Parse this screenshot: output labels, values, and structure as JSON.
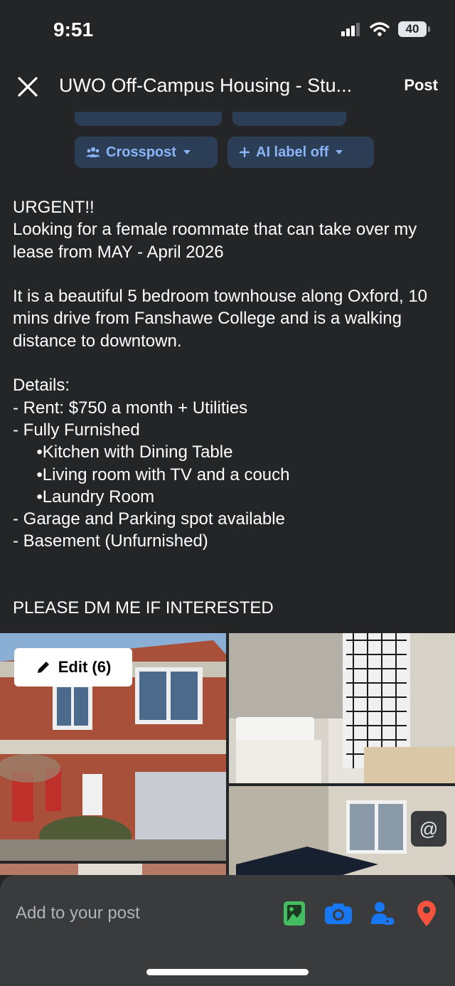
{
  "status_bar": {
    "time": "9:51",
    "battery": "40"
  },
  "header": {
    "title": "UWO Off-Campus Housing - Stu...",
    "post_label": "Post"
  },
  "chips": {
    "crosspost": "Crosspost",
    "ai_label": "AI label off"
  },
  "post": {
    "text": "URGENT!!\nLooking for a female roommate that can take over my lease from MAY - April 2026\n\nIt is a beautiful 5 bedroom townhouse along Oxford, 10 mins drive from Fanshawe College and is a walking distance to downtown.\n\nDetails:\n- Rent: $750 a month + Utilities\n- Fully Furnished\n     •Kitchen with Dining Table\n     •Living room with TV and a couch\n     •Laundry Room\n- Garage and Parking spot available\n- Basement (Unfurnished)\n\n\nPLEASE DM ME IF INTERESTED"
  },
  "photos": {
    "edit_label": "Edit (6)",
    "mention_icon": "@"
  },
  "composer": {
    "add_label": "Add to your post"
  },
  "colors": {
    "background": "#242526",
    "chip_bg": "#2c3e55",
    "chip_text": "#8ab4f8",
    "photo_icon": "#45bd62",
    "camera_icon": "#1877f2",
    "tag_icon": "#1877f2",
    "location_icon": "#f5533d"
  },
  "icons": [
    "close-icon",
    "signal-icon",
    "wifi-icon",
    "battery-icon",
    "crosspost-icon",
    "plus-icon",
    "chevron-down-icon",
    "pencil-icon",
    "at-icon",
    "photo-icon",
    "camera-icon",
    "tag-people-icon",
    "location-icon"
  ]
}
